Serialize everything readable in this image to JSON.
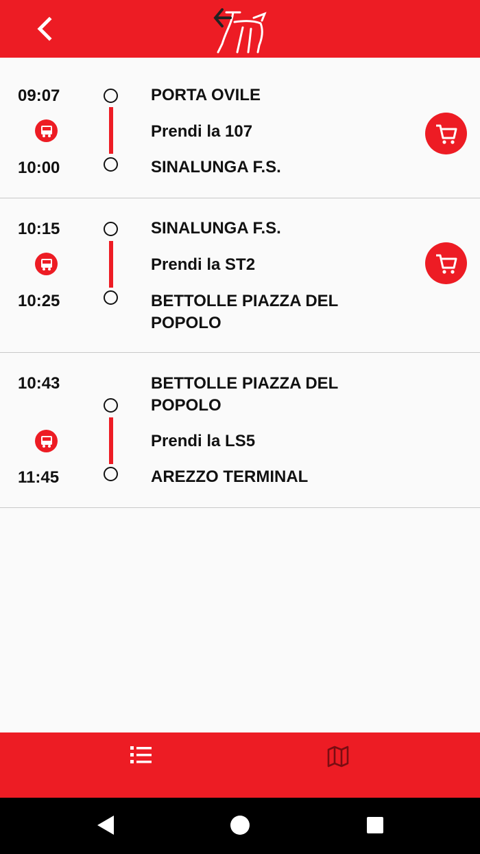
{
  "colors": {
    "accent": "#ed1c24",
    "background": "#fafafa",
    "text": "#111111"
  },
  "legs": [
    {
      "depart_time": "09:07",
      "arrive_time": "10:00",
      "from_stop": "PORTA OVILE",
      "ride_label": "Prendi la 107",
      "to_stop": "SINALUNGA F.S."
    },
    {
      "depart_time": "10:15",
      "arrive_time": "10:25",
      "from_stop": "SINALUNGA F.S.",
      "ride_label": "Prendi la ST2",
      "to_stop": "BETTOLLE PIAZZA DEL POPOLO"
    },
    {
      "depart_time": "10:43",
      "arrive_time": "11:45",
      "from_stop": "BETTOLLE PIAZZA DEL POPOLO",
      "ride_label": "Prendi la LS5",
      "to_stop": "AREZZO TERMINAL"
    }
  ],
  "icons": {
    "back": "chevron-left-icon",
    "logo": "centaur-logo",
    "bus": "bus-icon",
    "cart": "cart-icon",
    "list_tab": "list-icon",
    "map_tab": "map-icon"
  }
}
